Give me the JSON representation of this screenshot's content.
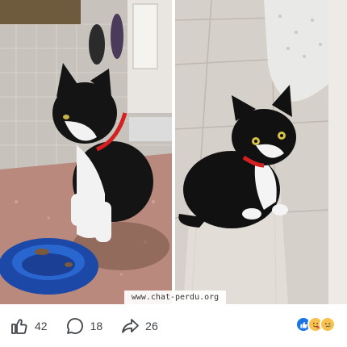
{
  "post": {
    "watermark": "www.chat-perdu.org",
    "images": [
      {
        "name": "photo-cat-eating",
        "description_icon": "cat-photo"
      },
      {
        "name": "photo-cat-sitting",
        "description_icon": "cat-photo"
      }
    ]
  },
  "actions": {
    "like": {
      "icon": "thumbs-up-icon",
      "count": "42"
    },
    "comment": {
      "icon": "comment-bubble-icon",
      "count": "18"
    },
    "share": {
      "icon": "share-arrow-icon",
      "count": "26"
    }
  },
  "reactions": [
    {
      "icon": "like-reaction-icon",
      "color": "#1b74e4"
    },
    {
      "icon": "care-reaction-icon",
      "color": "#f7c24d"
    },
    {
      "icon": "sad-reaction-icon",
      "color": "#f7c24d"
    }
  ],
  "colors": {
    "text": "#3f4348",
    "accent": "#1b74e4",
    "collar": "#d42020"
  }
}
